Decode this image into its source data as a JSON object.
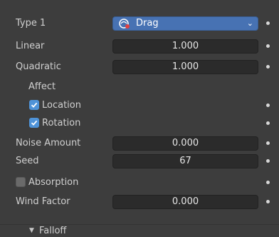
{
  "type_row": {
    "label": "Type 1",
    "value": "Drag",
    "icon": "drag-force-icon",
    "chevron": "⌄"
  },
  "linear": {
    "label": "Linear",
    "value": "1.000"
  },
  "quadratic": {
    "label": "Quadratic",
    "value": "1.000"
  },
  "affect": {
    "label": "Affect",
    "location": {
      "label": "Location",
      "checked": true
    },
    "rotation": {
      "label": "Rotation",
      "checked": true
    }
  },
  "noise_amount": {
    "label": "Noise Amount",
    "value": "0.000"
  },
  "seed": {
    "label": "Seed",
    "value": "67"
  },
  "absorption": {
    "label": "Absorption",
    "checked": false
  },
  "wind_factor": {
    "label": "Wind Factor",
    "value": "0.000"
  },
  "falloff": {
    "label": "Falloff",
    "expand_icon": "triangle-down-icon"
  },
  "colors": {
    "accent": "#4772b3",
    "checkbox_on": "#4f93d8",
    "panel_bg": "#3d3d3d",
    "field_bg": "#2b2b2b"
  }
}
